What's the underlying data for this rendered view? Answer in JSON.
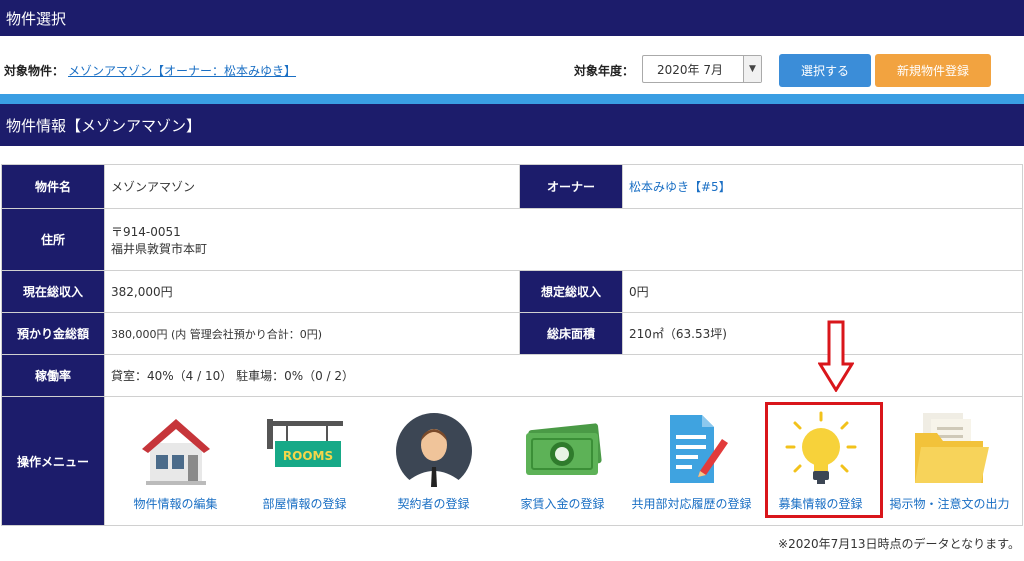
{
  "header1": "物件選択",
  "target": {
    "property_label": "対象物件：",
    "property_link": "メゾンアマゾン【オーナー：松本みゆき】",
    "year_label": "対象年度：",
    "year_value": "2020年 7月",
    "select_button": "選択する",
    "register_button": "新規物件登録"
  },
  "header2": "物件情報【メゾンアマゾン】",
  "info": {
    "name_label": "物件名",
    "name_value": "メゾンアマゾン",
    "owner_label": "オーナー",
    "owner_value": "松本みゆき【#5】",
    "address_label": "住所",
    "address_zip": "〒914-0051",
    "address_line": "福井県敦賀市本町",
    "income_label": "現在総収入",
    "income_value": "382,000円",
    "expected_label": "想定総収入",
    "expected_value": "0円",
    "deposit_label": "預かり金総額",
    "deposit_value": "380,000円 (内 管理会社預かり合計：0円)",
    "area_label": "総床面積",
    "area_value": "210㎡（63.53坪)",
    "occupancy_label": "稼働率",
    "occupancy_value": "貸室：40%（4 / 10） 駐車場：0%（0 / 2）",
    "menu_label": "操作メニュー"
  },
  "menu": [
    {
      "label": "物件情報の編集",
      "icon": "house-icon"
    },
    {
      "label": "部屋情報の登録",
      "icon": "rooms-sign-icon"
    },
    {
      "label": "契約者の登録",
      "icon": "person-icon"
    },
    {
      "label": "家賃入金の登録",
      "icon": "money-icon"
    },
    {
      "label": "共用部対応履歴の登録",
      "icon": "document-pen-icon"
    },
    {
      "label": "募集情報の登録",
      "icon": "lightbulb-icon"
    },
    {
      "label": "掲示物・注意文の出力",
      "icon": "folder-icon"
    }
  ],
  "rooms_sign_text": "ROOMS",
  "footer_note": "※2020年7月13日時点のデータとなります。",
  "colors": {
    "navy": "#1c1c6b",
    "strip": "#3a9ee3",
    "blue_button": "#3b8dd8",
    "orange_button": "#f2a340",
    "highlight": "#d9161b",
    "link": "#1a6fc4"
  }
}
